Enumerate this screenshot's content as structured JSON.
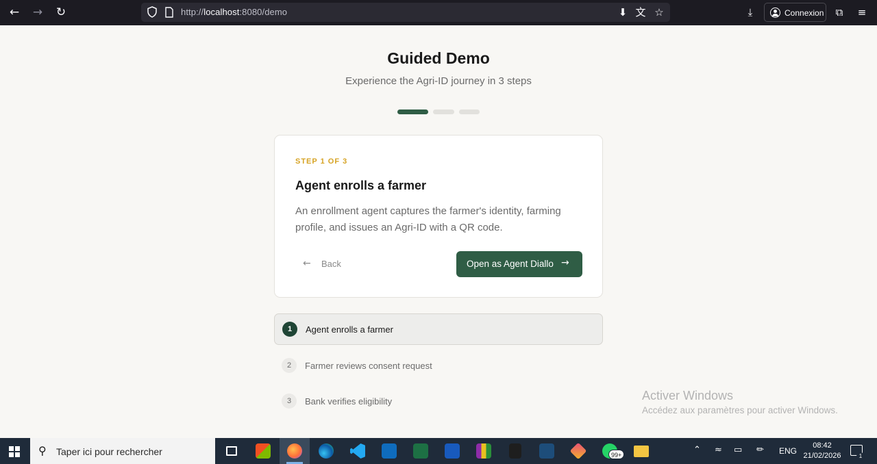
{
  "browser": {
    "url_prefix": "http://",
    "url_host": "localhost",
    "url_rest": ":8080/demo",
    "account_label": "Connexion"
  },
  "page": {
    "title": "Guided Demo",
    "subtitle": "Experience the Agri-ID journey in 3 steps",
    "progress": {
      "current_step": 1,
      "total_steps": 3
    }
  },
  "card": {
    "step_label": "STEP 1 OF 3",
    "title": "Agent enrolls a farmer",
    "description": "An enrollment agent captures the farmer's identity, farming profile, and issues an Agri-ID with a QR code.",
    "back_label": "Back",
    "primary_label": "Open as Agent Diallo"
  },
  "steps": [
    {
      "number": "1",
      "label": "Agent enrolls a farmer",
      "active": true
    },
    {
      "number": "2",
      "label": "Farmer reviews consent request",
      "active": false
    },
    {
      "number": "3",
      "label": "Bank verifies eligibility",
      "active": false
    }
  ],
  "watermark": {
    "title": "Activer Windows",
    "subtitle": "Accédez aux paramètres pour activer Windows."
  },
  "taskbar": {
    "search_placeholder": "Taper ici pour rechercher",
    "apps": [
      "task-view",
      "microsoft-store",
      "firefox",
      "edge",
      "vscode",
      "outlook",
      "excel",
      "word",
      "winrar",
      "figma",
      "mysql-workbench",
      "git-kraken",
      "whatsapp",
      "file-explorer"
    ],
    "whatsapp_badge": "99+",
    "language": "ENG",
    "time": "08:42",
    "date": "21/02/2026",
    "notification_count": "1"
  },
  "colors": {
    "accent": "#2f5d45",
    "step_label": "#d6a324",
    "background": "#f8f7f4"
  }
}
